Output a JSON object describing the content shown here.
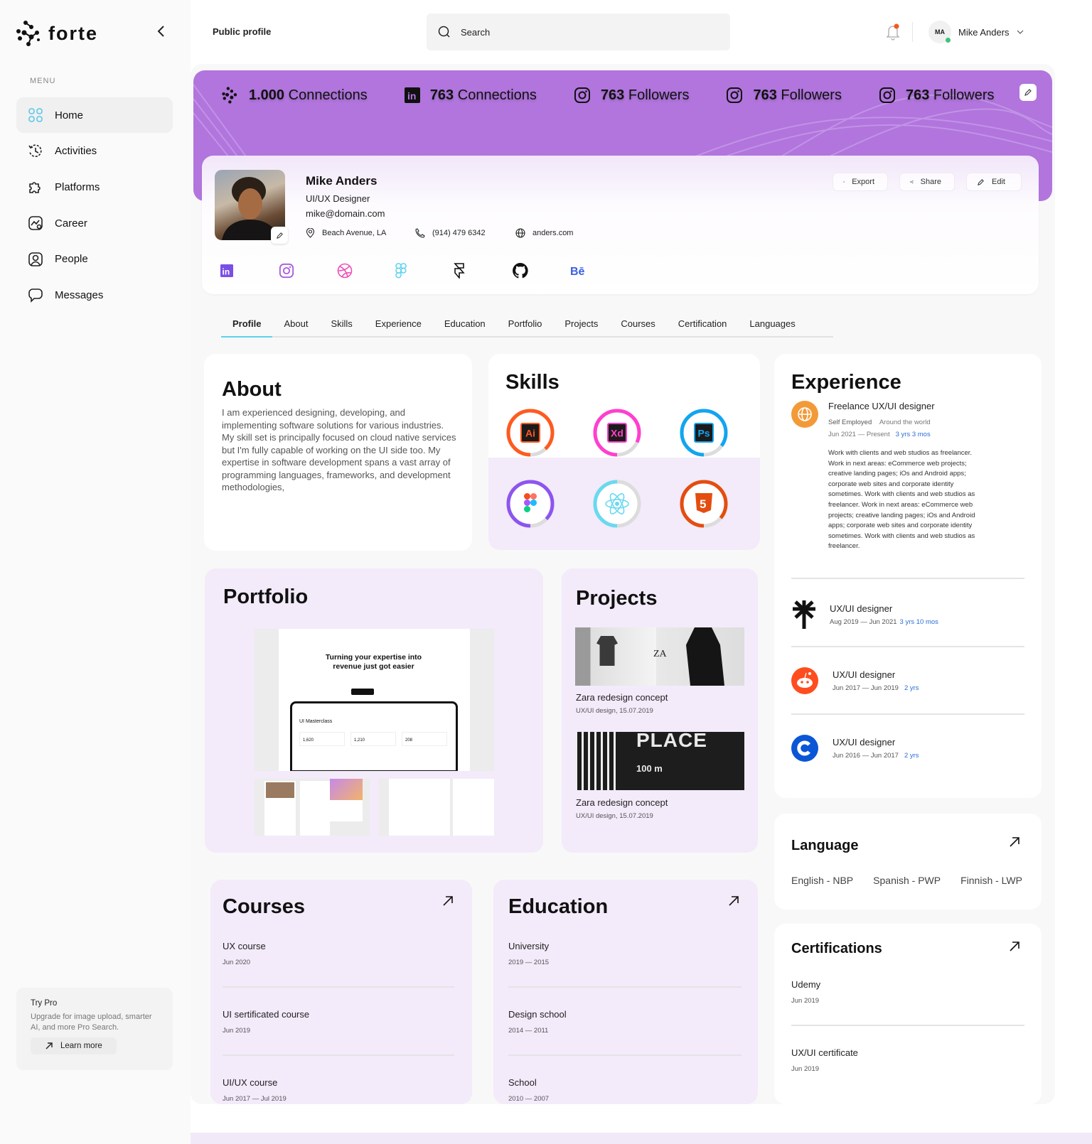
{
  "app": {
    "name": "forte"
  },
  "sidebar": {
    "menu_label": "MENU",
    "items": [
      {
        "label": "Home",
        "icon": "grid-icon",
        "active": true
      },
      {
        "label": "Activities",
        "icon": "history-icon"
      },
      {
        "label": "Platforms",
        "icon": "puzzle-icon"
      },
      {
        "label": "Career",
        "icon": "chart-icon"
      },
      {
        "label": "People",
        "icon": "user-icon"
      },
      {
        "label": "Messages",
        "icon": "message-icon"
      }
    ],
    "pro": {
      "title": "Try Pro",
      "description": "Upgrade for image upload, smarter AI, and more Pro Search.",
      "button": "Learn more"
    }
  },
  "header": {
    "title": "Public profile",
    "search_placeholder": "Search",
    "user_initials": "MA",
    "user_name": "Mike Anders"
  },
  "banner": {
    "stats": [
      {
        "icon": "forte-icon",
        "value": "1.000",
        "label": "Connections"
      },
      {
        "icon": "linkedin-icon",
        "value": "763",
        "label": "Connections"
      },
      {
        "icon": "instagram-icon",
        "value": "763",
        "label": "Followers"
      },
      {
        "icon": "instagram-icon",
        "value": "763",
        "label": "Followers"
      },
      {
        "icon": "instagram-icon",
        "value": "763",
        "label": "Followers"
      }
    ]
  },
  "profile": {
    "name": "Mike Anders",
    "role": "UI/UX Designer",
    "email": "mike@domain.com",
    "location": "Beach Avenue, LA",
    "phone": "(914) 479 6342",
    "website": "anders.com",
    "actions": {
      "export": "Export",
      "share": "Share",
      "edit": "Edit"
    },
    "socials": [
      "linkedin",
      "instagram",
      "dribbble",
      "figma",
      "framer",
      "github",
      "behance"
    ]
  },
  "tabs": [
    "Profile",
    "About",
    "Skills",
    "Experience",
    "Education",
    "Portfolio",
    "Projects",
    "Courses",
    "Certification",
    "Languages"
  ],
  "about": {
    "title": "About",
    "text": "I am experienced designing, developing, and implementing software solutions for various industries. My skill set is principally focused on cloud native services but I'm fully capable of working on the UI side too. My expertise in software development spans a vast array of programming languages, frameworks, and development methodologies,"
  },
  "skills": {
    "title": "Skills",
    "items": [
      {
        "name": "Illustrator",
        "label": "Ai",
        "color": "#ff5a1f",
        "level": 0.88
      },
      {
        "name": "Adobe XD",
        "label": "Xd",
        "color": "#ff3fd0",
        "level": 0.82
      },
      {
        "name": "Photoshop",
        "label": "Ps",
        "color": "#12a5ef",
        "level": 0.85
      },
      {
        "name": "Figma",
        "label": "",
        "color": "#8d55ef",
        "level": 0.87
      },
      {
        "name": "React",
        "label": "",
        "color": "#6ad9f0",
        "level": 0.5
      },
      {
        "name": "HTML5",
        "label": "5",
        "color": "#e44d0f",
        "level": 0.86
      }
    ]
  },
  "experience": {
    "title": "Experience",
    "items": [
      {
        "title": "Freelance UX/UI designer",
        "company": "Self Employed",
        "location": "Around the world",
        "dates": "Jun 2021 — Present",
        "duration": "3 yrs 3 mos",
        "logo": "globe-logo",
        "description": "Work with clients and web studios as freelancer.  Work in next areas: eCommerce web projects; creative landing pages; iOs and Android apps; corporate web sites and corporate identity sometimes. Work with clients and web studios as freelancer.  Work in next areas: eCommerce web projects; creative landing pages; iOs and Android apps; corporate web sites and corporate identity sometimes. Work with clients and web studios as freelancer."
      },
      {
        "title": "UX/UI designer",
        "dates": "Aug 2019 — Jun 2021",
        "duration": "3 yrs 10 mos",
        "logo": "asterisk-logo"
      },
      {
        "title": "UX/UI designer",
        "dates": "Jun 2017 — Jun 2019",
        "duration": "2 yrs",
        "logo": "reddit-logo"
      },
      {
        "title": "UX/UI designer",
        "dates": "Jun 2016 — Jun 2017",
        "duration": "2 yrs",
        "logo": "coinbase-logo"
      }
    ]
  },
  "portfolio": {
    "title": "Portfolio",
    "preview_headline": "Turning your expertise into revenue just got easier",
    "preview_dashboard_title": "UI Masterclass",
    "preview_stats": [
      "1,620",
      "1,210",
      "208"
    ]
  },
  "projects": {
    "title": "Projects",
    "items": [
      {
        "name": "Zara redesign concept",
        "meta": "UX/UI design, 15.07.2019",
        "image_text": "ZA"
      },
      {
        "name": "Zara redesign concept",
        "meta": "UX/UI design, 15.07.2019",
        "image_text": "PLACE",
        "image_sub": "100 m"
      }
    ]
  },
  "language": {
    "title": "Language",
    "items": [
      "English - NBP",
      "Spanish - PWP",
      "Finnish - LWP"
    ]
  },
  "courses": {
    "title": "Courses",
    "items": [
      {
        "name": "UX course",
        "date": "Jun 2020"
      },
      {
        "name": "UI sertificated course",
        "date": "Jun 2019"
      },
      {
        "name": "UI/UX course",
        "date": "Jun 2017 — Jul 2019"
      }
    ]
  },
  "education": {
    "title": "Education",
    "items": [
      {
        "name": "University",
        "date": "2019 — 2015"
      },
      {
        "name": "Design school",
        "date": "2014 — 2011"
      },
      {
        "name": "School",
        "date": "2010 — 2007"
      }
    ]
  },
  "certifications": {
    "title": "Certifications",
    "items": [
      {
        "name": "Udemy",
        "date": "Jun 2019"
      },
      {
        "name": "UX/UI certificate",
        "date": "Jun 2019"
      }
    ]
  }
}
